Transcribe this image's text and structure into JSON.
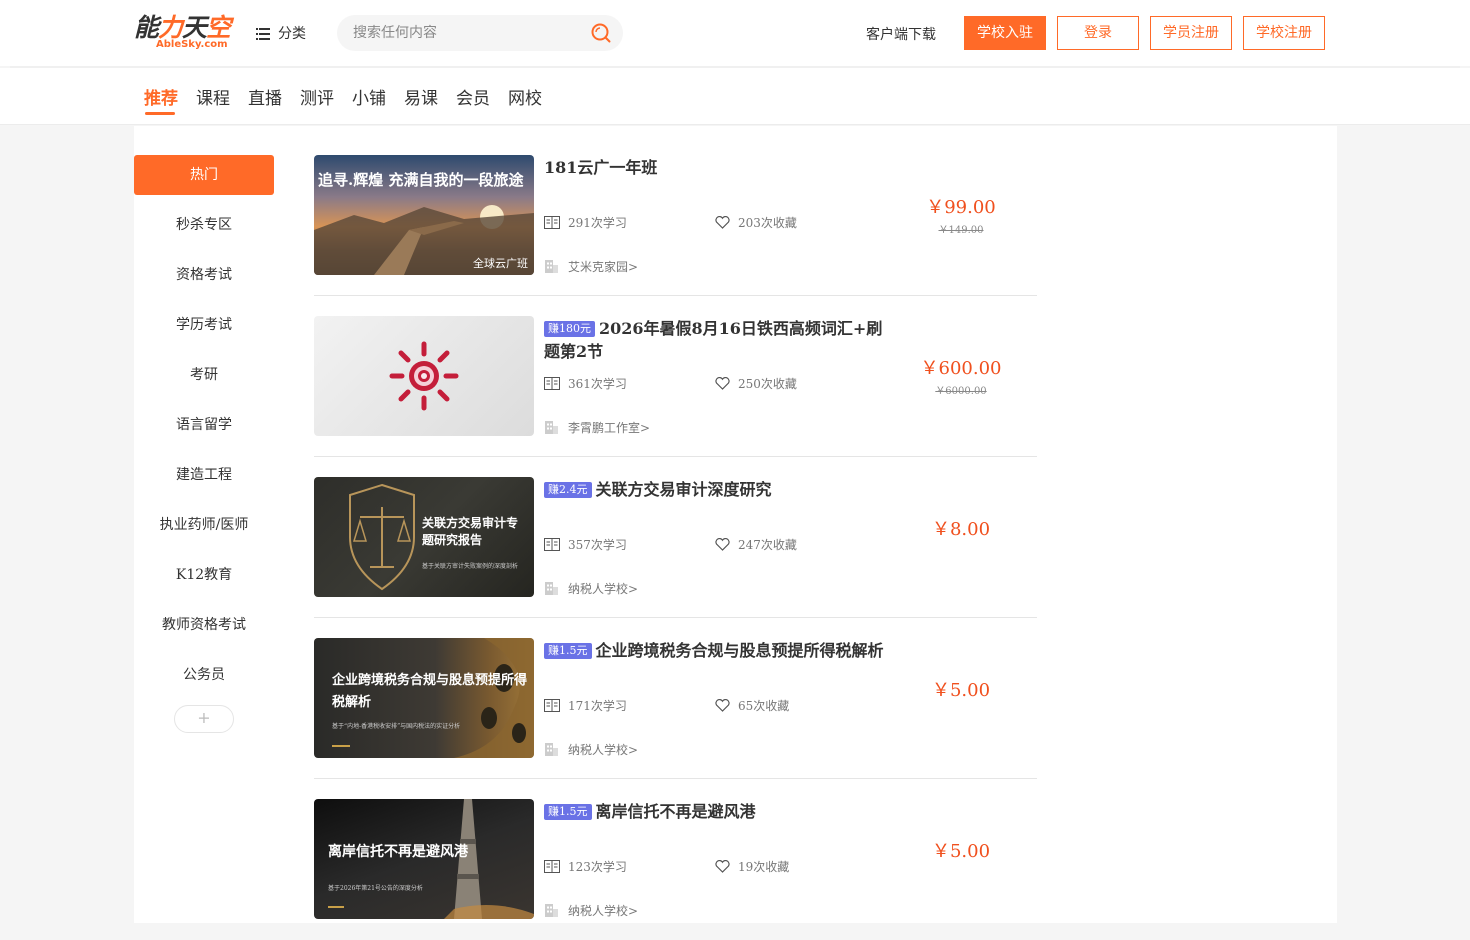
{
  "header": {
    "logo_text": "能力天空",
    "logo_sub": "AbleSky.com",
    "category_label": "分类",
    "search_placeholder": "搜索任何内容",
    "download_label": "客户端下载",
    "join_label": "学校入驻",
    "login_label": "登录",
    "student_register_label": "学员注册",
    "school_register_label": "学校注册",
    "accent_color": "#ff6a28"
  },
  "nav": {
    "tabs": [
      {
        "label": "推荐",
        "active": true
      },
      {
        "label": "课程"
      },
      {
        "label": "直播"
      },
      {
        "label": "测评"
      },
      {
        "label": "小铺"
      },
      {
        "label": "易课"
      },
      {
        "label": "会员"
      },
      {
        "label": "网校"
      }
    ]
  },
  "sidebar": {
    "items": [
      {
        "label": "热门",
        "active": true
      },
      {
        "label": "秒杀专区"
      },
      {
        "label": "资格考试"
      },
      {
        "label": "学历考试"
      },
      {
        "label": "考研"
      },
      {
        "label": "语言留学"
      },
      {
        "label": "建造工程"
      },
      {
        "label": "执业药师/医师"
      },
      {
        "label": "K12教育"
      },
      {
        "label": "教师资格考试"
      },
      {
        "label": "公务员"
      }
    ],
    "more_label": "+"
  },
  "courses": [
    {
      "title": "181云广一年班",
      "earn": "",
      "learners": "291次学习",
      "favorites": "203次收藏",
      "school": "艾米克家园>",
      "price": "￥99.00",
      "old_price": "￥149.00",
      "thumb_text": "追寻.辉煌 充满自我的一段旅途",
      "thumb_sub": "全球云广班"
    },
    {
      "title": "2026年暑假8月16日铁西高频词汇+刷题第2节",
      "earn": "赚180元",
      "learners": "361次学习",
      "favorites": "250次收藏",
      "school": "李霄鹏工作室>",
      "price": "￥600.00",
      "old_price": "￥6000.00"
    },
    {
      "title": "关联方交易审计深度研究",
      "earn": "赚2.4元",
      "learners": "357次学习",
      "favorites": "247次收藏",
      "school": "纳税人学校>",
      "price": "￥8.00",
      "old_price": "",
      "thumb_text": "关联方交易审计专题研究报告",
      "thumb_sub": "基于关联方审计失败案例的深度剖析"
    },
    {
      "title": "企业跨境税务合规与股息预提所得税解析",
      "earn": "赚1.5元",
      "learners": "171次学习",
      "favorites": "65次收藏",
      "school": "纳税人学校>",
      "price": "￥5.00",
      "old_price": "",
      "thumb_text": "企业跨境税务合规与股息预提所得税解析",
      "thumb_sub": "基于“内地-香港税收安排”与国内税法的实证分析"
    },
    {
      "title": "离岸信托不再是避风港",
      "earn": "赚1.5元",
      "learners": "123次学习",
      "favorites": "19次收藏",
      "school": "纳税人学校>",
      "price": "￥5.00",
      "old_price": "",
      "thumb_text": "离岸信托不再是避风港",
      "thumb_sub": "基于2026年第21号公告的深度分析"
    }
  ]
}
